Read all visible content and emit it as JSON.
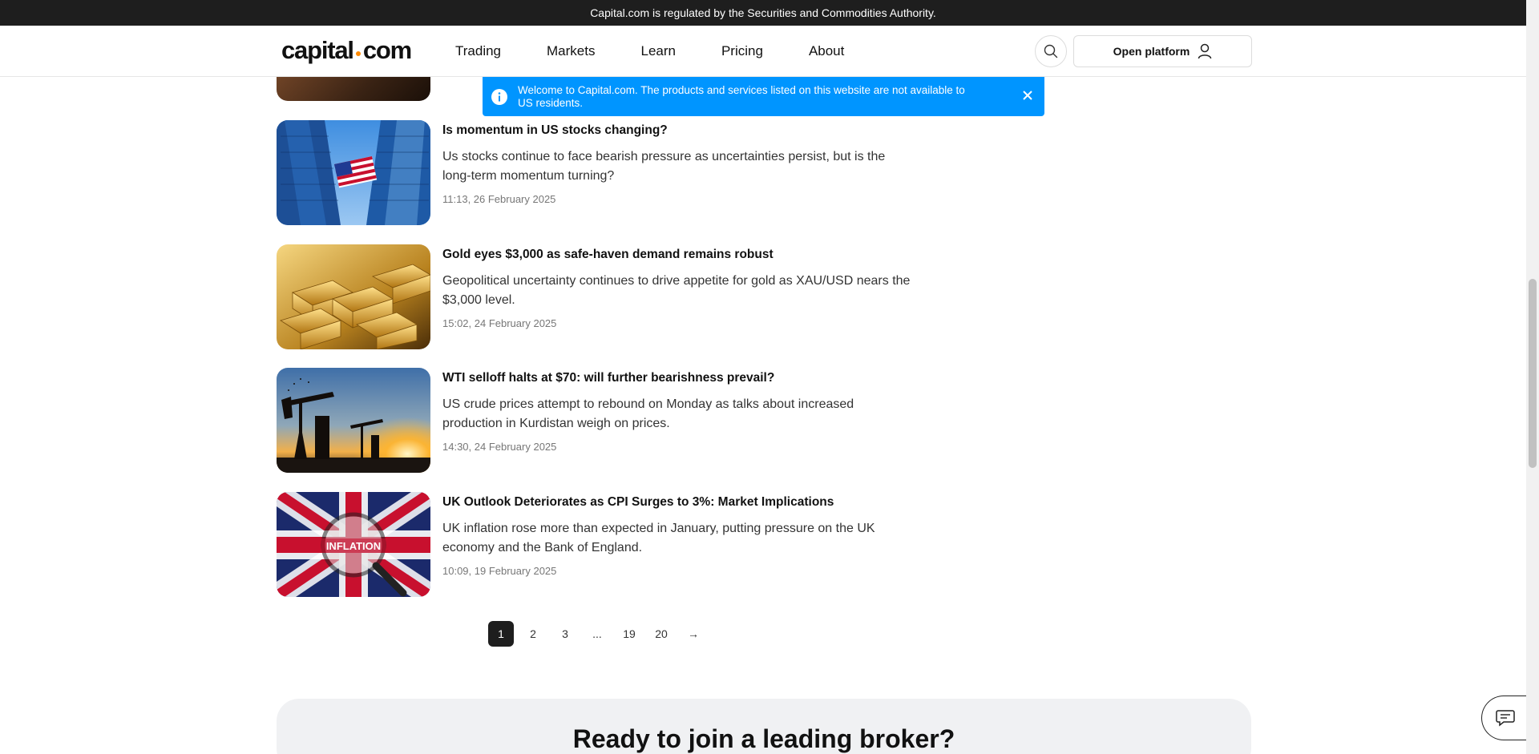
{
  "topbar": {
    "text": "Capital.com is regulated by the Securities and Commodities Authority."
  },
  "header": {
    "logo_left": "capital",
    "logo_right": "com",
    "nav": [
      "Trading",
      "Markets",
      "Learn",
      "Pricing",
      "About"
    ],
    "open_platform": "Open platform",
    "icons": {
      "search": "search-icon",
      "user": "user-icon"
    }
  },
  "banner": {
    "text": "Welcome to Capital.com. The products and services listed on this website are not available to US residents.",
    "color": "#0095ff"
  },
  "articles": [
    {
      "title": "Is momentum in US stocks changing?",
      "description": "Us stocks continue to face bearish pressure as uncertainties persist, but is the long-term momentum turning?",
      "date": "11:13, 26 February 2025"
    },
    {
      "title": "Gold eyes $3,000 as safe-haven demand remains robust",
      "description": "Geopolitical uncertainty continues to drive appetite for gold as XAU/USD nears the $3,000 level.",
      "date": "15:02, 24 February 2025"
    },
    {
      "title": "WTI selloff halts at $70: will further bearishness prevail?",
      "description": "US crude prices attempt to rebound on Monday as talks about increased production in Kurdistan weigh on prices.",
      "date": "14:30, 24 February 2025"
    },
    {
      "title": "UK Outlook Deteriorates as CPI Surges to 3%: Market Implications",
      "description": "UK inflation rose more than expected in January, putting pressure on the UK economy and the Bank of England.",
      "date": "10:09, 19 February 2025",
      "image_text": "INFLATION"
    }
  ],
  "pagination": {
    "pages": [
      "1",
      "2",
      "3",
      "...",
      "19",
      "20"
    ],
    "current": "1",
    "next": "→"
  },
  "cta": {
    "title": "Ready to join a leading broker?"
  },
  "colors": {
    "brand_accent": "#ff8a00",
    "dark": "#1e1e1e"
  }
}
